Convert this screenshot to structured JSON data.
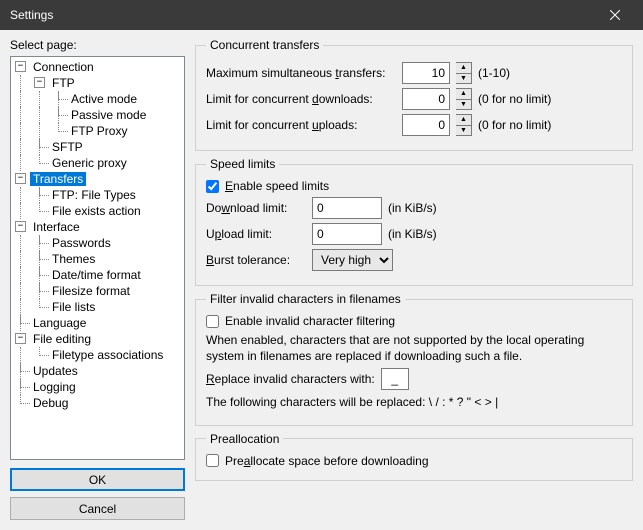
{
  "window": {
    "title": "Settings",
    "close_icon": "close"
  },
  "sidebar": {
    "label": "Select page:",
    "ok": "OK",
    "cancel": "Cancel",
    "tree": {
      "connection": {
        "label": "Connection",
        "ftp": {
          "label": "FTP",
          "active": "Active mode",
          "passive": "Passive mode",
          "proxy": "FTP Proxy"
        },
        "sftp": "SFTP",
        "generic_proxy": "Generic proxy"
      },
      "transfers": {
        "label": "Transfers",
        "file_types": "FTP: File Types",
        "file_exists": "File exists action"
      },
      "interface": {
        "label": "Interface",
        "passwords": "Passwords",
        "themes": "Themes",
        "datetime": "Date/time format",
        "filesize": "Filesize format",
        "filelists": "File lists"
      },
      "language": "Language",
      "file_editing": {
        "label": "File editing",
        "assoc": "Filetype associations"
      },
      "updates": "Updates",
      "logging": "Logging",
      "debug": "Debug"
    }
  },
  "concurrent": {
    "legend": "Concurrent transfers",
    "max_label_pre": "Maximum simultaneous ",
    "max_label_u": "t",
    "max_label_post": "ransfers:",
    "max_value": "10",
    "max_hint": "(1-10)",
    "dl_label_pre": "Limit for concurrent ",
    "dl_label_u": "d",
    "dl_label_post": "ownloads:",
    "dl_value": "0",
    "dl_hint": "(0 for no limit)",
    "ul_label_pre": "Limit for concurrent ",
    "ul_label_u": "u",
    "ul_label_post": "ploads:",
    "ul_value": "0",
    "ul_hint": "(0 for no limit)"
  },
  "speed": {
    "legend": "Speed limits",
    "enable_u": "E",
    "enable_post": "nable speed limits",
    "dl_pre": "Do",
    "dl_u": "w",
    "dl_post": "nload limit:",
    "dl_value": "0",
    "dl_unit": "(in KiB/s)",
    "ul_pre": "U",
    "ul_u": "p",
    "ul_post": "load limit:",
    "ul_value": "0",
    "ul_unit": "(in KiB/s)",
    "burst_u": "B",
    "burst_post": "urst tolerance:",
    "burst_value": "Very high"
  },
  "filter": {
    "legend": "Filter invalid characters in filenames",
    "enable": "Enable invalid character filtering",
    "desc": "When enabled, characters that are not supported by the local operating system in filenames are replaced if downloading such a file.",
    "replace_u": "R",
    "replace_post": "eplace invalid characters with:",
    "replace_value": "_",
    "list": "The following characters will be replaced: \\ / : * ? \" < > |"
  },
  "prealloc": {
    "legend": "Preallocation",
    "label_pre": "Pre",
    "label_u": "a",
    "label_post": "llocate space before downloading"
  }
}
